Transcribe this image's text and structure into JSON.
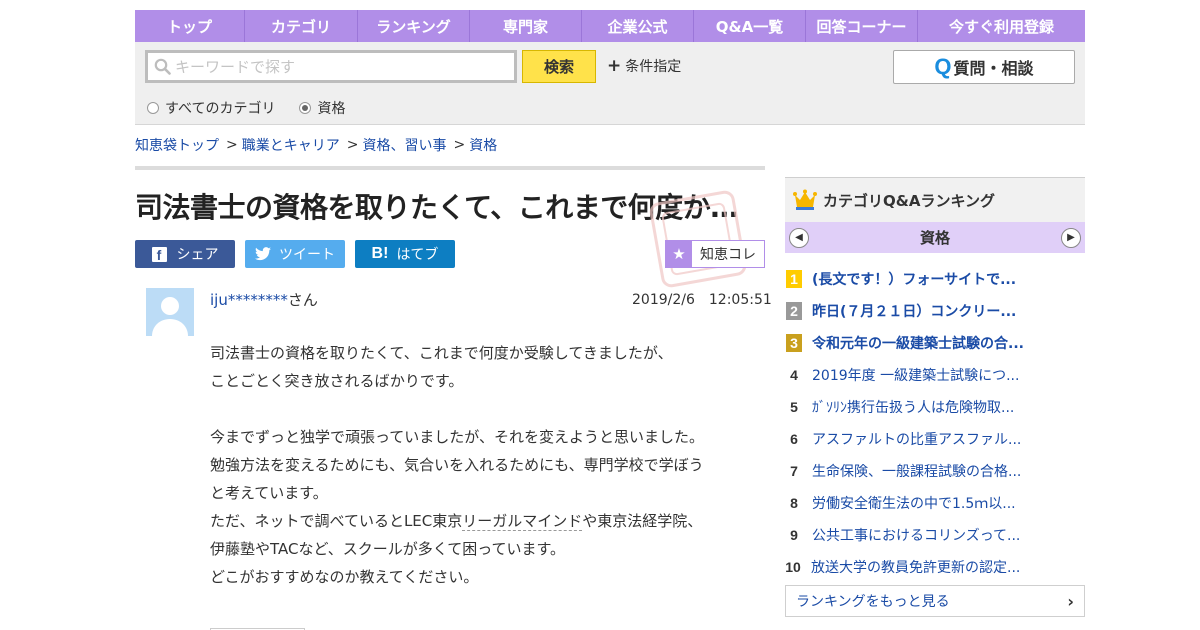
{
  "nav": {
    "items": [
      "トップ",
      "カテゴリ",
      "ランキング",
      "専門家",
      "企業公式",
      "Q&A一覧",
      "回答コーナー",
      "今すぐ利用登録"
    ]
  },
  "search": {
    "placeholder": "キーワードで探す",
    "button_label": "検索",
    "conditions_label": "条件指定",
    "ask_q": "Q",
    "ask_label": "質問・相談",
    "radio_all": "すべてのカテゴリ",
    "radio_current": "資格"
  },
  "breadcrumb": {
    "items": [
      "知恵袋トップ",
      "職業とキャリア",
      "資格、習い事",
      "資格"
    ]
  },
  "question": {
    "title": "司法書士の資格を取りたくて、これまで何度か…",
    "share_fb": "シェア",
    "share_tw": "ツイート",
    "share_hb": "はてブ",
    "chie_collection": "知恵コレ",
    "user_id": "iju********",
    "user_suffix": "さん",
    "date": "2019/2/6　12:05:51",
    "body": {
      "line1": "司法書士の資格を取りたくて、これまで何度か受験してきましたが、",
      "line2": "ことごとく突き放されるばかりです。",
      "line3": "今までずっと独学で頑張っていましたが、それを変えようと思いました。",
      "line4": "勉強方法を変えるためにも、気合いを入れるためにも、専門学校で学ぼう",
      "line5": "と考えています。",
      "line6_a": "ただ、ネットで調べているとLEC東京",
      "line6_kw": "リーガルマインド",
      "line6_b": "や東京法経学院、",
      "line7": "伊藤塾やTACなど、スクールが多くて困っています。",
      "line8": "どこがおすすめなのか教えてください。"
    }
  },
  "ranking": {
    "title": "カテゴリQ&Aランキング",
    "category": "資格",
    "items": [
      {
        "rank": "1",
        "text": "(長文です！）フォーサイトで..."
      },
      {
        "rank": "2",
        "text": "昨日(７月２１日）コンクリー..."
      },
      {
        "rank": "3",
        "text": "令和元年の一級建築士試験の合..."
      },
      {
        "rank": "4",
        "text": "2019年度 一級建築士試験につ..."
      },
      {
        "rank": "5",
        "text": "ｶﾞｿﾘﾝ携行缶扱う人は危険物取..."
      },
      {
        "rank": "6",
        "text": "アスファルトの比重アスファル..."
      },
      {
        "rank": "7",
        "text": "生命保険、一般課程試験の合格..."
      },
      {
        "rank": "8",
        "text": "労働安全衛生法の中で1.5ｍ以..."
      },
      {
        "rank": "9",
        "text": "公共工事におけるコリンズって..."
      },
      {
        "rank": "10",
        "text": "放送大学の教員免許更新の認定..."
      }
    ],
    "more_label": "ランキングをもっと見る"
  },
  "colors": {
    "nav": "#b18ee8",
    "search_button": "#ffe24a",
    "link": "#1a4ba6",
    "facebook": "#3b5998",
    "twitter": "#55acee",
    "hatena": "#0d7ec2",
    "rank1": "#ffcc00",
    "rank2": "#999999",
    "rank3": "#c9a01e"
  }
}
